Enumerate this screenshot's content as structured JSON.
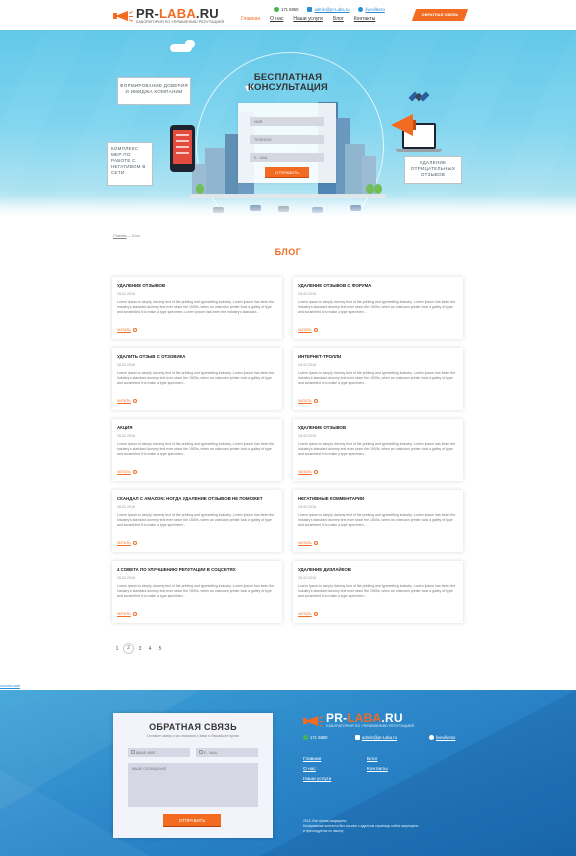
{
  "header": {
    "logo": {
      "part1": "PR-",
      "part2": "LABA",
      "part3": ".RU",
      "tagline": "ЛАБОРАТОРИЯ ПО УПРАВЛЕНИЮ РЕПУТАЦИЕЙ"
    },
    "contacts": {
      "phone": "171 5850",
      "email": "admin@pr-Laba.ru",
      "skype": "livevillerso"
    },
    "nav": [
      {
        "label": "Главная",
        "active": true
      },
      {
        "label": "О нас",
        "active": false
      },
      {
        "label": "Наши услуги",
        "active": false
      },
      {
        "label": "Блог",
        "active": false
      },
      {
        "label": "Контакты",
        "active": false
      }
    ],
    "callback_label": "ОБРАТНАЯ СВЯЗЬ"
  },
  "hero": {
    "title": "БЕСПЛАТНАЯ КОНСУЛЬТАЦИЯ",
    "name_placeholder": "ИМЯ",
    "phone_placeholder": "ТЕЛЕФОН",
    "email_placeholder": "E - MAIL",
    "submit_label": "ОТПРАВИТЬ",
    "bubble_left_top": "ФОРМИРОВАНИЕ ДОВЕРИЯ И ИМИДЖА КОМПАНИИ",
    "bubble_left_bottom": "КОМПЛЕКС МЕР ПО РАБОТЕ С НЕГАТИВОМ В СЕТИ",
    "bubble_right": "УДАЛЕНИЕ ОТРИЦАТЕЛЬНЫХ ОТЗЫВОВ"
  },
  "breadcrumb": {
    "home": "Главная",
    "separator": "—",
    "current": "Блог"
  },
  "page_title": "БЛОГ",
  "read_more_label": "ЧИТАТЬ",
  "posts": [
    {
      "title": "УДАЛЕНИЕ ОТЗЫВОВ",
      "date": "28.02.2016",
      "excerpt": "Lorem Ipsum is simply dummy text of the printing and typesetting industry. Lorem Ipsum has been the industry's standard dummy text ever since the 1500s, when an unknown printer took a galley of type and scrambled it to make a type specimen. Lorem Ipsum has been the industry's standard..."
    },
    {
      "title": "УДАЛЕНИЕ ОТЗЫВОВ С ФОРУМА",
      "date": "28.02.2016",
      "excerpt": "Lorem Ipsum is simply dummy text of the printing and typesetting industry. Lorem Ipsum has been the industry's standard dummy text ever since the 1500s, when an unknown printer took a galley of type and scrambled it to make a type specimen..."
    },
    {
      "title": "УДАЛИТЬ ОТЗЫВ С ОТЗОВИКА",
      "date": "28.02.2016",
      "excerpt": "Lorem Ipsum is simply dummy text of the printing and typesetting industry. Lorem Ipsum has been the industry's standard dummy text ever since the 1500s, when an unknown printer took a galley of type and scrambled it to make a type specimen..."
    },
    {
      "title": "ИНТЕРНЕТ-ТРОЛЛИ",
      "date": "28.02.2016",
      "excerpt": "Lorem Ipsum is simply dummy text of the printing and typesetting industry. Lorem Ipsum has been the industry's standard dummy text ever since the 1500s, when an unknown printer took a galley of type and scrambled it to make a type specimen..."
    },
    {
      "title": "АКЦИЯ",
      "date": "28.02.2016",
      "excerpt": "Lorem Ipsum is simply dummy text of the printing and typesetting industry. Lorem Ipsum has been the industry's standard dummy text ever since the 1500s, when an unknown printer took a galley of type and scrambled it to make a type specimen..."
    },
    {
      "title": "УДАЛЕНИЕ ОТЗЫВОВ",
      "date": "28.02.2016",
      "excerpt": "Lorem Ipsum is simply dummy text of the printing and typesetting industry. Lorem Ipsum has been the industry's standard dummy text ever since the 1500s, when an unknown printer took a galley of type and scrambled it to make a type specimen..."
    },
    {
      "title": "СКАНДАЛ С AMAZON: НОГДА УДАЛЕНИЕ ОТЗЫВОВ НЕ ПОМОЖЕТ",
      "date": "28.02.2016",
      "excerpt": "Lorem Ipsum is simply dummy text of the printing and typesetting industry. Lorem Ipsum has been the industry's standard dummy text ever since the 1500s, when an unknown printer took a galley of type and scrambled it to make a type specimen..."
    },
    {
      "title": "НЕГАТИВНЫЕ КОММЕНТАРИИ",
      "date": "28.02.2016",
      "excerpt": "Lorem Ipsum is simply dummy text of the printing and typesetting industry. Lorem Ipsum has been the industry's standard dummy text ever since the 1500s, when an unknown printer took a galley of type and scrambled it to make a type specimen..."
    },
    {
      "title": "4 СОВЕТА ПО УЛУЧШЕНИЮ РЕПУТАЦИИ В СОЦСЕТЯХ",
      "date": "28.02.2016",
      "excerpt": "Lorem Ipsum is simply dummy text of the printing and typesetting industry. Lorem Ipsum has been the industry's standard dummy text ever since the 1500s, when an unknown printer took a galley of type and scrambled it to make a type specimen..."
    },
    {
      "title": "УДАЛЕНИЕ ДИЗЛАЙКОВ",
      "date": "28.02.2016",
      "excerpt": "Lorem Ipsum is simply dummy text of the printing and typesetting industry. Lorem Ipsum has been the industry's standard dummy text ever since the 1500s, when an unknown printer took a galley of type and scrambled it to make a type specimen..."
    }
  ],
  "pagination": {
    "pages": [
      "1",
      "2",
      "3",
      "4",
      "5"
    ],
    "current": "2"
  },
  "tiny_link": "success.wait",
  "footer": {
    "feedback": {
      "title": "ОБРАТНАЯ СВЯЗЬ",
      "subtitle": "Оставьте заявку и мы свяжемся с вами в ближайшее время",
      "name_placeholder": "ВАШЕ ИМЯ",
      "email_placeholder": "E - MAIL",
      "message_placeholder": "ВАШЕ СООБЩЕНИЕ",
      "submit_label": "ОТПРАВИТЬ"
    },
    "logo": {
      "part1": "PR-",
      "part2": "LABA",
      "part3": ".RU",
      "tagline": "ЛАБОРАТОРИЯ ПО УПРАВЛЕНИЮ РЕПУТАЦИЕЙ"
    },
    "contacts": {
      "phone": "171 5850",
      "email": "admin@pr-Laba.ru",
      "skype": "livevillerso"
    },
    "nav": {
      "col1": [
        "Главная",
        "О нас",
        "Наши услуги"
      ],
      "col2": [
        "Блог",
        "Контакты"
      ]
    },
    "copyright_line1": "2016. Все права защищены",
    "copyright_line2": "Копирование контента без ссылки с адресом страницы сайта запрещено",
    "copyright_line3": "и преследуется по закону"
  },
  "colors": {
    "accent": "#f26b21",
    "link": "#2b8dd6",
    "hero_sky": "#5dc6e8",
    "footer_blue": "#2c87c9"
  }
}
